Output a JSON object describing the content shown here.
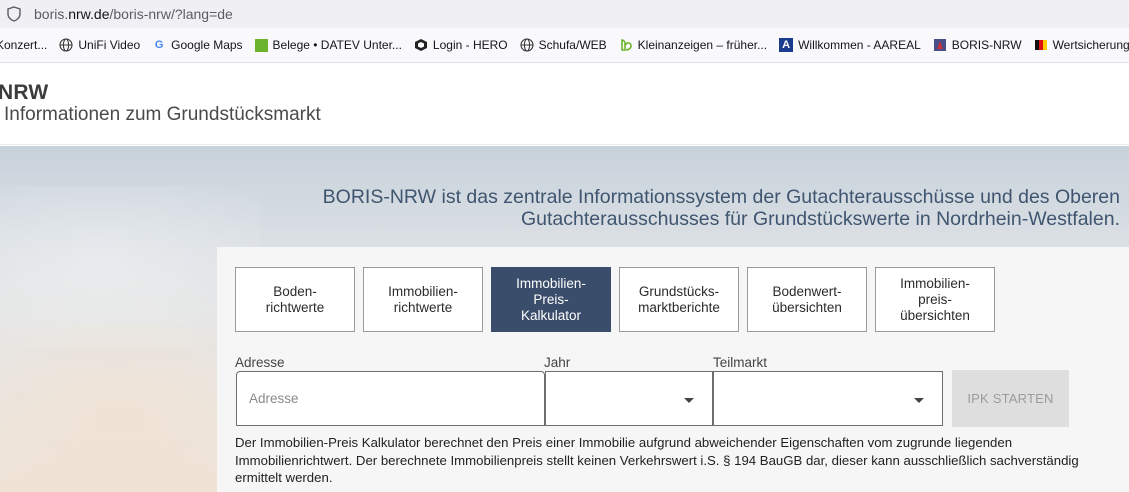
{
  "browser": {
    "url_prefix": "boris.",
    "url_host": "nrw.de",
    "url_path": "/boris-nrw/?lang=de",
    "bookmarks": [
      {
        "label": "Konzert...",
        "icon": "none"
      },
      {
        "label": "UniFi Video",
        "icon": "globe-icon"
      },
      {
        "label": "Google Maps",
        "icon": "google-icon"
      },
      {
        "label": "Belege • DATEV Unter...",
        "icon": "datev-icon"
      },
      {
        "label": "Login - HERO",
        "icon": "hero-icon"
      },
      {
        "label": "Schufa/WEB",
        "icon": "globe-icon"
      },
      {
        "label": "Kleinanzeigen – früher...",
        "icon": "kleinanzeigen-icon"
      },
      {
        "label": "Willkommen - AAREAL",
        "icon": "aareal-icon"
      },
      {
        "label": "BORIS-NRW",
        "icon": "boris-icon"
      },
      {
        "label": "Wertsicherungs",
        "icon": "flag-icon"
      }
    ]
  },
  "header": {
    "title": "NRW",
    "subtitle": "Informationen zum Grundstücksmarkt"
  },
  "hero": {
    "tagline_line1": "BORIS-NRW ist das zentrale Informationssystem der Gutachterausschüsse und des Oberen",
    "tagline_line2": "Gutachterausschusses für Grundstückswerte in Nordrhein-Westfalen."
  },
  "tiles": [
    {
      "label": "Boden-\nrichtwerte",
      "active": false
    },
    {
      "label": "Immobilien-\nrichtwerte",
      "active": false
    },
    {
      "label": "Immobilien-\nPreis-\nKalkulator",
      "active": true
    },
    {
      "label": "Grundstücks-\nmarktberichte",
      "active": false
    },
    {
      "label": "Bodenwert-\nübersichten",
      "active": false
    },
    {
      "label": "Immobilien-\npreis-\nübersichten",
      "active": false
    }
  ],
  "form": {
    "address_label": "Adresse",
    "address_placeholder": "Adresse",
    "year_label": "Jahr",
    "year_value": "",
    "submarket_label": "Teilmarkt",
    "submarket_value": "",
    "start_button": "IPK STARTEN"
  },
  "description": "Der Immobilien-Preis Kalkulator berechnet den Preis einer Immobilie aufgrund abweichender Eigenschaften vom zugrunde liegenden Immobilienrichtwert. Der berechnete Immobilienpreis stellt keinen Verkehrswert i.S. § 194 BauGB dar, dieser kann ausschließlich sachverständig ermittelt werden.",
  "colors": {
    "active_tile": "#3a4d6a",
    "tagline": "#3f5570"
  }
}
